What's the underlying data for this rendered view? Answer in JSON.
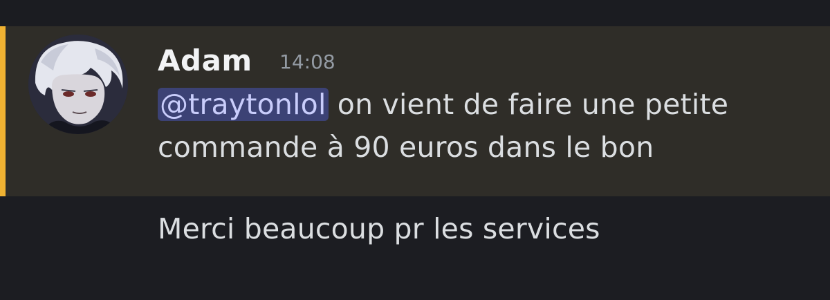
{
  "message": {
    "author": "Adam",
    "timestamp": "14:08",
    "mention": "@traytonlol",
    "line1_rest": " on vient de faire une petite",
    "line2": "commande à 90 euros dans le bon"
  },
  "followup_message": "Merci beaucoup pr les services",
  "colors": {
    "background": "#1c1d22",
    "highlight": "#2f2d28",
    "mention_bar": "#f0b232",
    "mention_bg": "#3c4275",
    "mention_text": "#c9cdfb"
  },
  "icons": {
    "avatar": "user-avatar-icon"
  }
}
